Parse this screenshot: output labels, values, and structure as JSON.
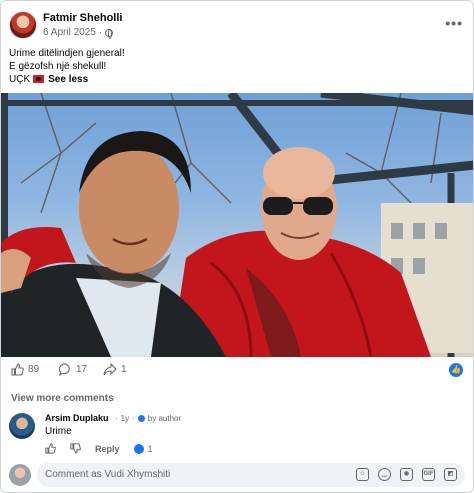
{
  "post": {
    "author": "Fatmir Sheholli",
    "date": "6 April 2025",
    "date_sep": "·",
    "more_icon": "more-horizontal-icon",
    "text_line1": "Urime ditëlindjen gjeneral!",
    "text_line2": "E gëzofsh një shekull!",
    "text_line3": "UÇK",
    "see_less": "See less"
  },
  "stats": {
    "likes": "89",
    "comments": "17",
    "shares": "1"
  },
  "view_more_comments": "View more comments",
  "comment": {
    "author": "Arsim Duplaku",
    "time": "1y",
    "sep": "·",
    "badge": "by author",
    "text": "Urime",
    "reply": "Reply",
    "likes": "1"
  },
  "composer": {
    "placeholder": "Comment as Vudi Xhymshiti"
  },
  "colors": {
    "accent": "#1877f2",
    "secondary_text": "#65676b",
    "input_bg": "#f0f2f5"
  }
}
